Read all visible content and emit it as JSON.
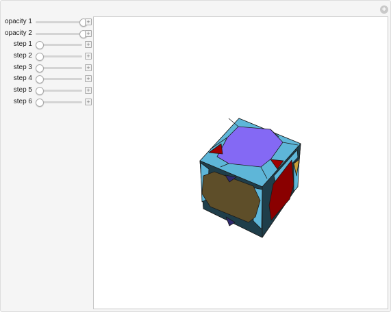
{
  "controls": [
    {
      "label": "opacity 1",
      "value": 1.0
    },
    {
      "label": "opacity 2",
      "value": 1.0
    },
    {
      "label": "step 1",
      "value": 0.0
    },
    {
      "label": "step 2",
      "value": 0.0
    },
    {
      "label": "step 3",
      "value": 0.0
    },
    {
      "label": "step 4",
      "value": 0.0
    },
    {
      "label": "step 5",
      "value": 0.0
    },
    {
      "label": "step 6",
      "value": 0.0
    }
  ],
  "icons": {
    "corner": "plus-circle-icon",
    "stepper": "plus-square-icon"
  },
  "colors": {
    "frame": "#f5f5f5",
    "cube_light_blue": "#5eb6d8",
    "cube_dark": "#1f3e4a",
    "top_face_purple": "#8469f4",
    "left_face_olive": "#5e4e29",
    "right_face_red": "#8a0000",
    "small_triangle_red": "#a00000",
    "small_triangle_gold": "#c8a03a",
    "small_triangle_indigo": "#2e2a6e"
  }
}
